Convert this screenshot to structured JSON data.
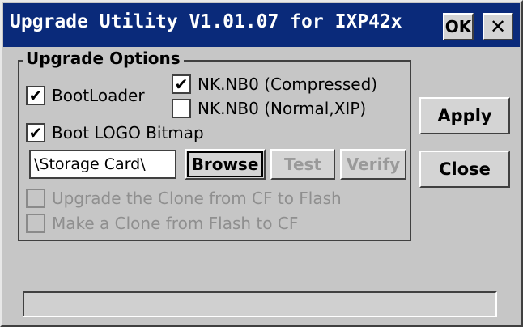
{
  "window": {
    "title": "Upgrade Utility V1.01.07 for IXP42x",
    "ok_label": "OK",
    "close_glyph": "✕"
  },
  "options": {
    "legend": "Upgrade Options",
    "bootloader": {
      "label": "BootLoader",
      "checked": true
    },
    "nk_compressed": {
      "label": "NK.NB0 (Compressed)",
      "checked": true
    },
    "nk_normal": {
      "label": "NK.NB0 (Normal,XIP)",
      "checked": false
    },
    "boot_logo": {
      "label": "Boot LOGO Bitmap",
      "checked": true
    },
    "path_value": "\\Storage Card\\",
    "browse_label": "Browse",
    "test_label": "Test",
    "verify_label": "Verify",
    "clone_cf_to_flash": {
      "label": "Upgrade the Clone from CF to Flash",
      "checked": false,
      "enabled": false
    },
    "clone_flash_to_cf": {
      "label": "Make a Clone from Flash to CF",
      "checked": false,
      "enabled": false
    }
  },
  "actions": {
    "apply_label": "Apply",
    "close_label": "Close"
  },
  "progress": {
    "value": 0
  },
  "colors": {
    "titlebar": "#0a2a7a",
    "face": "#c6c6c6"
  }
}
